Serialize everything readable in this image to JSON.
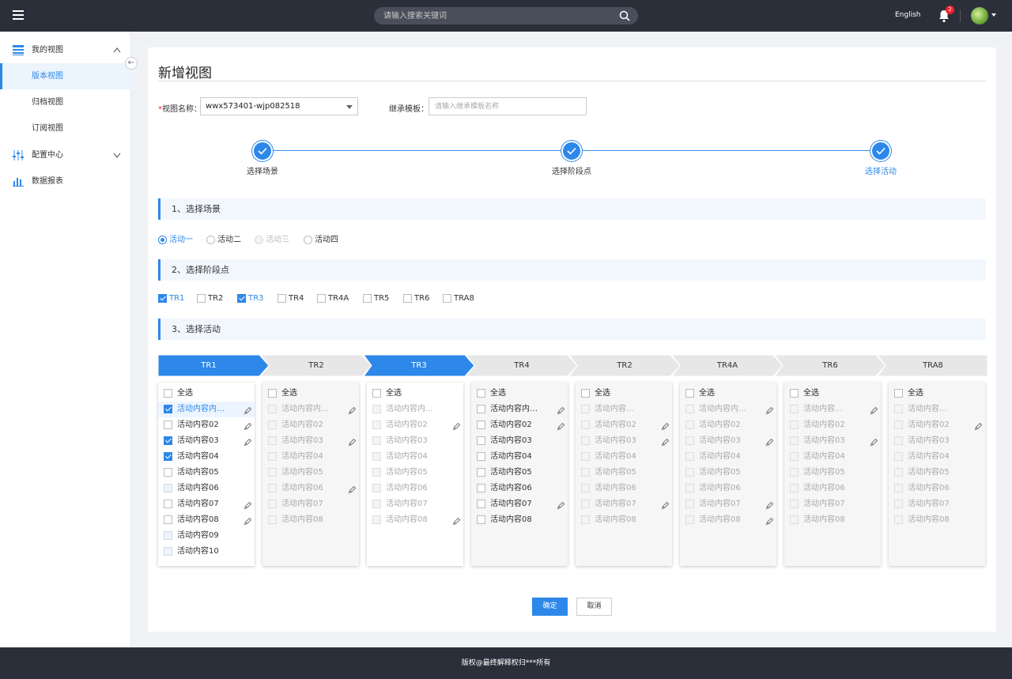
{
  "topbar": {
    "search_placeholder": "请输入搜索关键词",
    "language": "English",
    "notification_count": "2"
  },
  "sidebar": {
    "groups": [
      {
        "label": "我的视图",
        "icon": "view-list-icon",
        "expanded": true,
        "children": [
          {
            "label": "版本视图",
            "active": true
          },
          {
            "label": "归档视图"
          },
          {
            "label": "订阅视图"
          }
        ]
      },
      {
        "label": "配置中心",
        "icon": "sliders-icon",
        "expanded": false
      },
      {
        "label": "数据报表",
        "icon": "bar-chart-icon"
      }
    ]
  },
  "page": {
    "title": "新增视图",
    "view_name_label": "视图名称：",
    "view_name_value": "wwx573401-wjp082518",
    "template_label": "继承模板：",
    "template_placeholder": "请输入继承模板名称"
  },
  "steps": [
    {
      "label": "选择场景",
      "done": true
    },
    {
      "label": "选择阶段点",
      "done": true
    },
    {
      "label": "选择活动",
      "done": true,
      "current": true
    }
  ],
  "sections": {
    "scene": "1、选择场景",
    "stage": "2、选择阶段点",
    "activity": "3、选择活动"
  },
  "scene_options": [
    {
      "label": "活动一",
      "state": "selected"
    },
    {
      "label": "活动二",
      "state": "normal"
    },
    {
      "label": "活动三",
      "state": "disabled"
    },
    {
      "label": "活动四",
      "state": "normal"
    }
  ],
  "stage_options": [
    {
      "label": "TR1",
      "checked": true
    },
    {
      "label": "TR2",
      "checked": false
    },
    {
      "label": "TR3",
      "checked": true
    },
    {
      "label": "TR4",
      "checked": false
    },
    {
      "label": "TR4A",
      "checked": false
    },
    {
      "label": "TR5",
      "checked": false
    },
    {
      "label": "TR6",
      "checked": false
    },
    {
      "label": "TRA8",
      "checked": false
    }
  ],
  "activity_tabs": [
    {
      "label": "TR1",
      "active": true
    },
    {
      "label": "TR2",
      "active": false
    },
    {
      "label": "TR3",
      "active": true
    },
    {
      "label": "TR4",
      "active": false
    },
    {
      "label": "TR2",
      "active": false
    },
    {
      "label": "TR4A",
      "active": false
    },
    {
      "label": "TR6",
      "active": false
    },
    {
      "label": "TRA8",
      "active": false
    }
  ],
  "select_all_label": "全选",
  "columns": [
    {
      "white": true,
      "dim": false,
      "items": [
        {
          "label": "活动内容内容...",
          "checked": true,
          "edit": true,
          "highlight": true
        },
        {
          "label": "活动内容02",
          "checked": false,
          "edit": true
        },
        {
          "label": "活动内容03",
          "checked": true,
          "edit": true
        },
        {
          "label": "活动内容04",
          "checked": true,
          "edit": false
        },
        {
          "label": "活动内容05",
          "checked": false,
          "edit": false
        },
        {
          "label": "活动内容06",
          "checked": false,
          "edit": false,
          "boxdim": true
        },
        {
          "label": "活动内容07",
          "checked": false,
          "edit": true
        },
        {
          "label": "活动内容08",
          "checked": false,
          "edit": true
        },
        {
          "label": "活动内容09",
          "checked": false,
          "edit": false,
          "boxdim": true
        },
        {
          "label": "活动内容10",
          "checked": false,
          "edit": false,
          "boxdim": true
        }
      ]
    },
    {
      "white": false,
      "dim": true,
      "items": [
        {
          "label": "活动内容内...",
          "edit": true
        },
        {
          "label": "活动内容02"
        },
        {
          "label": "活动内容03",
          "edit": true
        },
        {
          "label": "活动内容04"
        },
        {
          "label": "活动内容05"
        },
        {
          "label": "活动内容06",
          "edit": true
        },
        {
          "label": "活动内容07"
        },
        {
          "label": "活动内容08"
        }
      ]
    },
    {
      "white": true,
      "dim": true,
      "items": [
        {
          "label": "活动内容内..."
        },
        {
          "label": "活动内容02",
          "edit": true
        },
        {
          "label": "活动内容03"
        },
        {
          "label": "活动内容04"
        },
        {
          "label": "活动内容05"
        },
        {
          "label": "活动内容06"
        },
        {
          "label": "活动内容07"
        },
        {
          "label": "活动内容08",
          "edit": true
        }
      ]
    },
    {
      "white": false,
      "dim": false,
      "items": [
        {
          "label": "活动内容内容...",
          "edit": true
        },
        {
          "label": "活动内容02",
          "edit": true
        },
        {
          "label": "活动内容03"
        },
        {
          "label": "活动内容04"
        },
        {
          "label": "活动内容05"
        },
        {
          "label": "活动内容06"
        },
        {
          "label": "活动内容07",
          "edit": true
        },
        {
          "label": "活动内容08"
        }
      ]
    },
    {
      "white": false,
      "dim": true,
      "items": [
        {
          "label": "活动内容..."
        },
        {
          "label": "活动内容02",
          "edit": true
        },
        {
          "label": "活动内容03",
          "edit": true
        },
        {
          "label": "活动内容04"
        },
        {
          "label": "活动内容05"
        },
        {
          "label": "活动内容06"
        },
        {
          "label": "活动内容07",
          "edit": true
        },
        {
          "label": "活动内容08"
        }
      ]
    },
    {
      "white": false,
      "dim": true,
      "items": [
        {
          "label": "活动内容内...",
          "edit": true
        },
        {
          "label": "活动内容02"
        },
        {
          "label": "活动内容03",
          "edit": true
        },
        {
          "label": "活动内容04"
        },
        {
          "label": "活动内容05"
        },
        {
          "label": "活动内容06"
        },
        {
          "label": "活动内容07",
          "edit": true
        },
        {
          "label": "活动内容08",
          "edit": true
        }
      ]
    },
    {
      "white": false,
      "dim": true,
      "items": [
        {
          "label": "活动内容...",
          "edit": true
        },
        {
          "label": "活动内容02"
        },
        {
          "label": "活动内容03",
          "edit": true
        },
        {
          "label": "活动内容04"
        },
        {
          "label": "活动内容05"
        },
        {
          "label": "活动内容06"
        },
        {
          "label": "活动内容07"
        },
        {
          "label": "活动内容08"
        }
      ]
    },
    {
      "white": false,
      "dim": true,
      "items": [
        {
          "label": "活动内容..."
        },
        {
          "label": "活动内容02",
          "edit": true
        },
        {
          "label": "活动内容03"
        },
        {
          "label": "活动内容04"
        },
        {
          "label": "活动内容05"
        },
        {
          "label": "活动内容06"
        },
        {
          "label": "活动内容07"
        },
        {
          "label": "活动内容08"
        }
      ]
    }
  ],
  "buttons": {
    "confirm": "确定",
    "cancel": "取消"
  },
  "footer": "版权@最终解释权归***所有",
  "colors": {
    "primary": "#2d88ea",
    "topbar": "#2b2f3a",
    "badge": "#f5222d"
  }
}
